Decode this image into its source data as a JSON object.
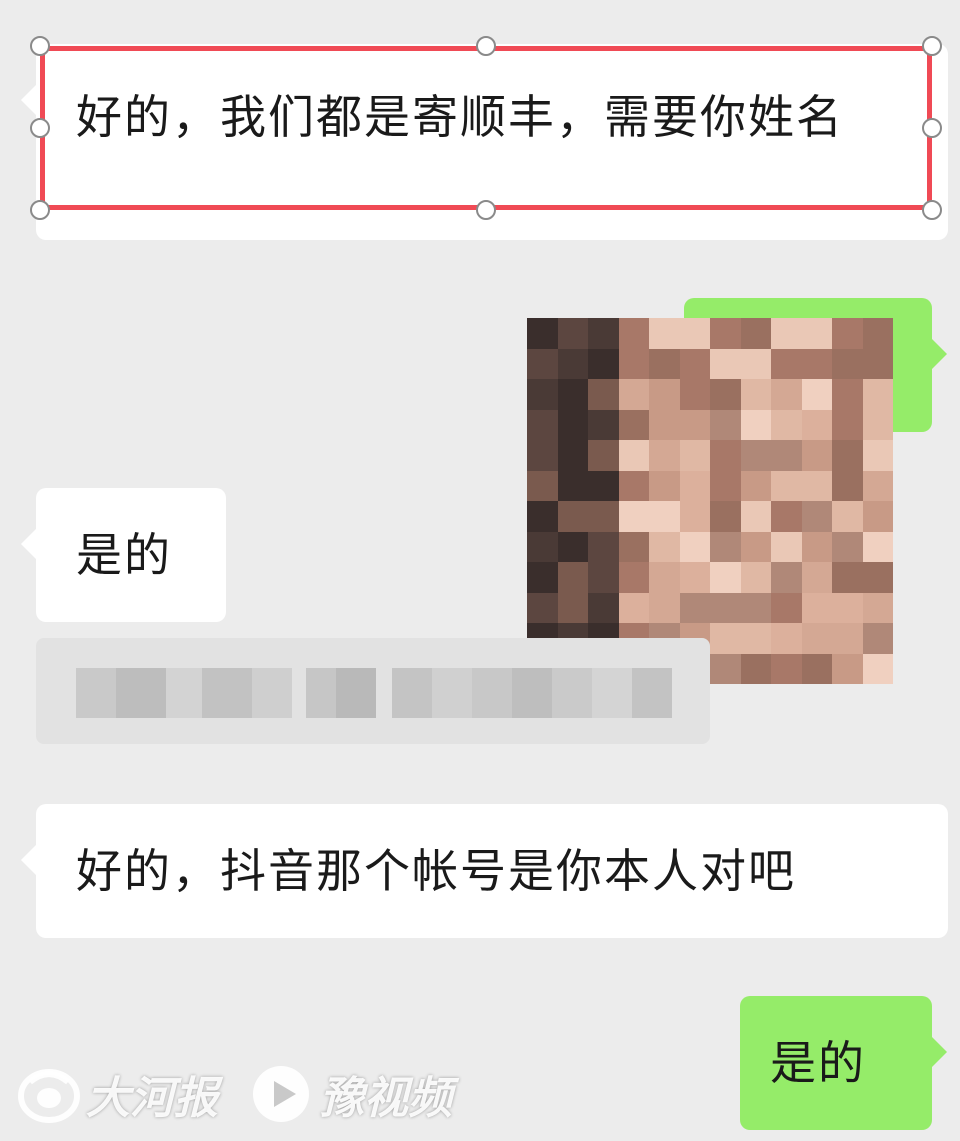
{
  "messages": [
    {
      "id": "msg1",
      "side": "incoming",
      "text": "好的，我们都是寄顺丰，需要你姓名"
    },
    {
      "id": "msg2",
      "side": "incoming",
      "text": "是的"
    },
    {
      "id": "msg3",
      "side": "incoming",
      "text": "好的，抖音那个帐号是你本人对吧"
    },
    {
      "id": "msg4",
      "side": "outgoing",
      "text": "是的"
    }
  ],
  "photo": {
    "icon": "pixelated-selfie-image"
  },
  "watermark": {
    "brand_a": "大河报",
    "brand_b": "豫视频"
  },
  "colors": {
    "background": "#ececec",
    "incoming_bubble": "#ffffff",
    "outgoing_bubble": "#95ec69",
    "selection": "#f04a55"
  }
}
